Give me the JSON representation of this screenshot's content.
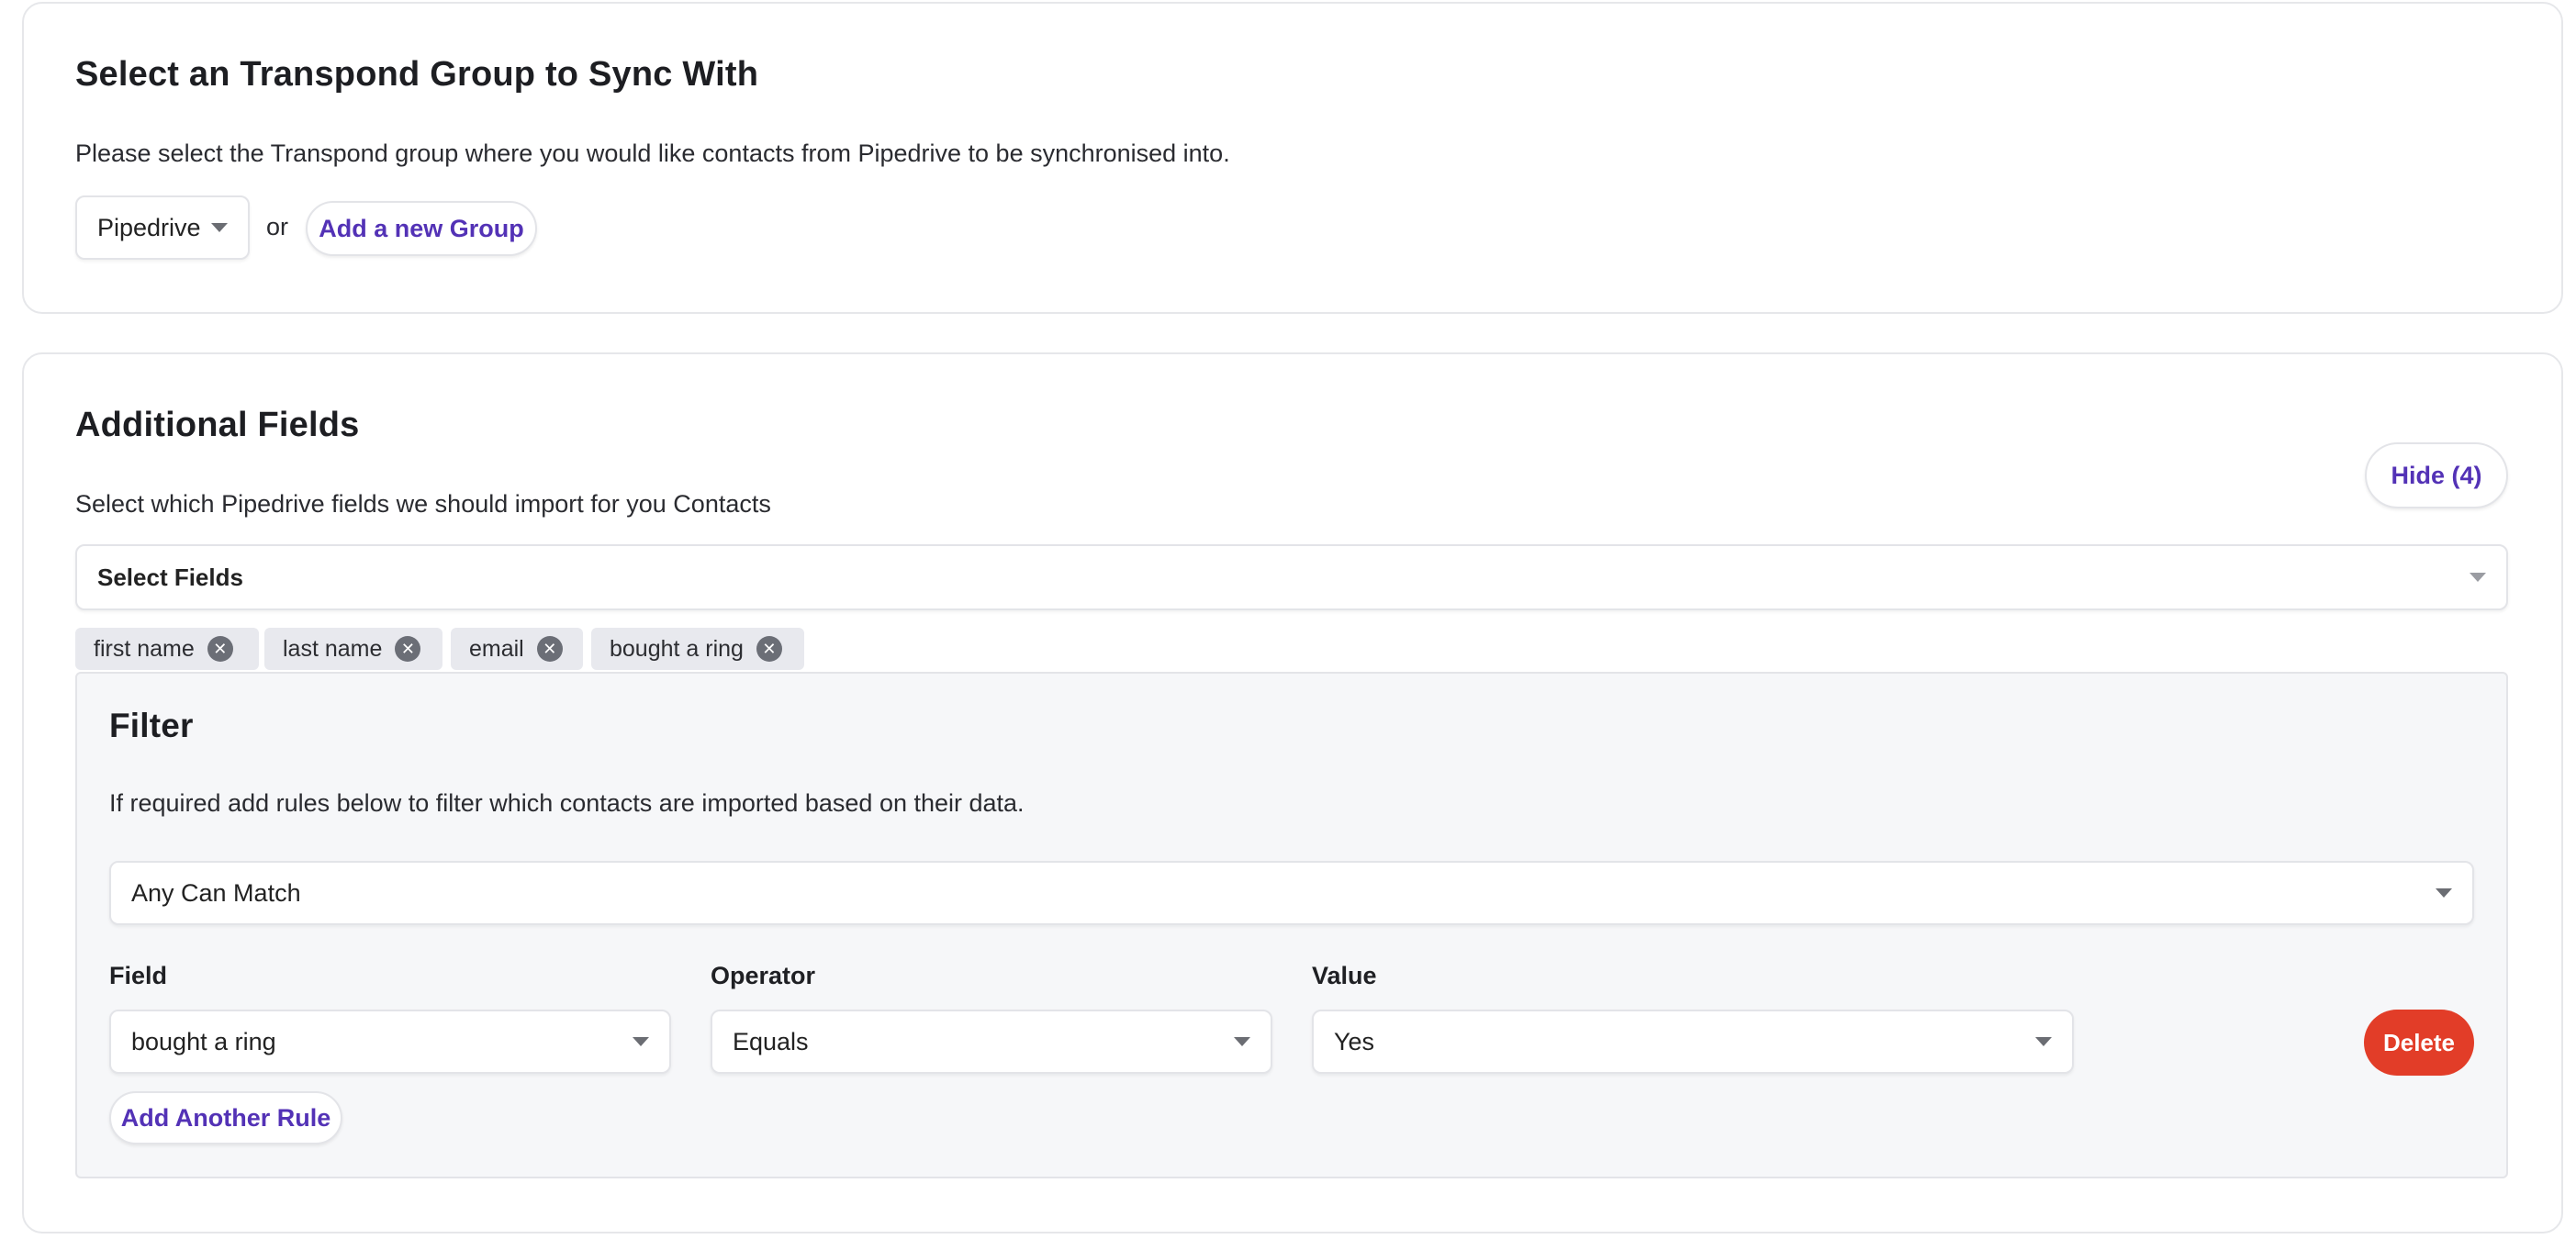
{
  "sync_group": {
    "title": "Select an Transpond Group to Sync With",
    "description": "Please select the Transpond group where you would like contacts from Pipedrive to be synchronised into.",
    "selected_group": "Pipedrive",
    "or_text": "or",
    "add_group_label": "Add a new Group"
  },
  "additional_fields": {
    "title": "Additional Fields",
    "description": "Select which Pipedrive fields we should import for you Contacts",
    "hide_label": "Hide (4)",
    "select_placeholder": "Select Fields",
    "tags": [
      "first name",
      "last name",
      "email",
      "bought a ring"
    ],
    "tag_remove_glyph": "✕"
  },
  "filter": {
    "title": "Filter",
    "description": "If required add rules below to filter which contacts are imported based on their data.",
    "match_mode": "Any Can Match",
    "columns": {
      "field": "Field",
      "operator": "Operator",
      "value": "Value"
    },
    "rule": {
      "field": "bought a ring",
      "operator": "Equals",
      "value": "Yes"
    },
    "delete_label": "Delete",
    "add_rule_label": "Add Another Rule"
  },
  "icons": {
    "dropdown": "caret-down-icon",
    "remove": "close-circle-icon"
  },
  "colors": {
    "accent": "#5332b6",
    "danger": "#e23d28",
    "tag_bg": "#e8e9ee",
    "panel_bg": "#f6f7f9"
  }
}
